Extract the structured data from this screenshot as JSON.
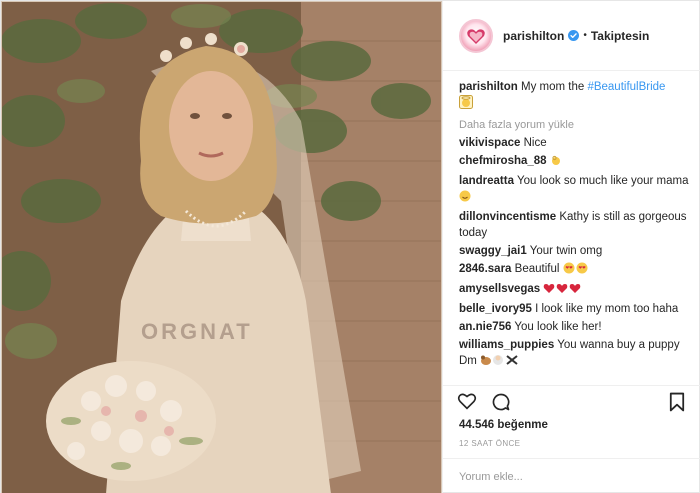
{
  "photo": {
    "subject": "vintage bridal portrait",
    "dress_text": "ORGNAT"
  },
  "header": {
    "username": "parishilton",
    "separator": "•",
    "follow_label": "Takiptesin"
  },
  "caption": {
    "username": "parishilton",
    "text": "My mom the ",
    "hashtag": "#BeautifulBride"
  },
  "load_more_label": "Daha fazla yorum yükle",
  "comments": [
    {
      "username": "vikivispace",
      "text": "Nice"
    },
    {
      "username": "chefmirosha_88",
      "text": ""
    },
    {
      "username": "landreatta",
      "text": "You look so much like your mama"
    },
    {
      "username": "dillonvincentisme",
      "text": "Kathy is still as gorgeous today"
    },
    {
      "username": "swaggy_jai1",
      "text": "Your twin omg"
    },
    {
      "username": "2846.sara",
      "text": "Beautiful"
    },
    {
      "username": "amysellsvegas",
      "text": ""
    },
    {
      "username": "belle_ivory95",
      "text": "I look like my mom too haha"
    },
    {
      "username": "an.nie756",
      "text": "You look like her!"
    },
    {
      "username": "williams_puppies",
      "text": "You wanna buy a puppy Dm"
    }
  ],
  "likes": "44.546 beğenme",
  "timestamp": "12 SAAT ÖNCE",
  "add_comment_placeholder": "Yorum ekle...",
  "colors": {
    "link": "#3897f0",
    "verified": "#3897f0",
    "muted": "#999999",
    "heart_emoji": "#d7263d"
  },
  "icons": [
    "verified-badge-icon",
    "heart-icon",
    "comment-icon",
    "bookmark-icon",
    "emoji-icons"
  ]
}
